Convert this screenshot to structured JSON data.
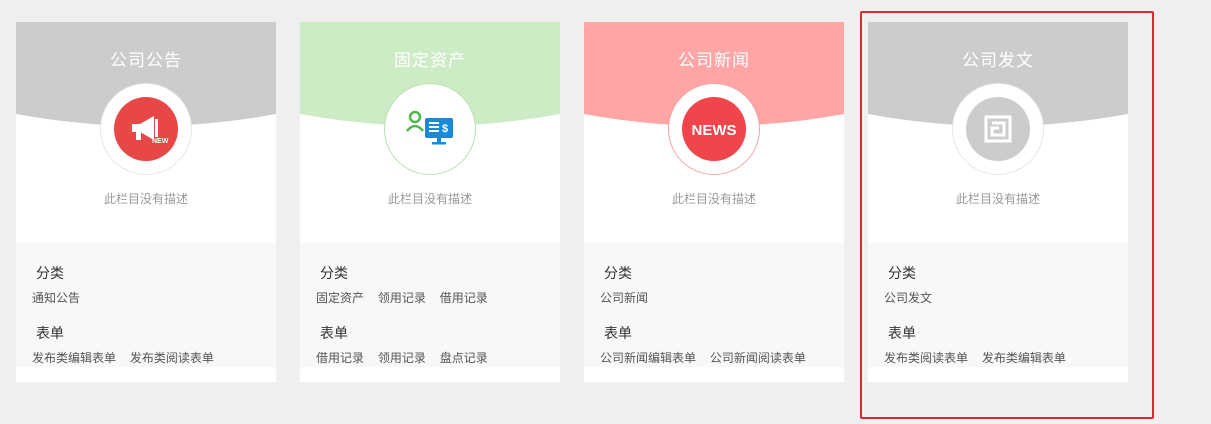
{
  "cards": [
    {
      "title": "公司公告",
      "header_color": "#cccccc",
      "icon": "megaphone-new-icon",
      "icon_color": "#e84747",
      "icon_text": "NEW",
      "description": "此栏目没有描述",
      "category_label": "分类",
      "categories": [
        "通知公告"
      ],
      "form_label": "表单",
      "forms": [
        "发布类编辑表单",
        "发布类阅读表单"
      ]
    },
    {
      "title": "固定资产",
      "header_color": "#cdecc6",
      "icon": "asset-monitor-icon",
      "icon_color": "#ffffff",
      "description": "此栏目没有描述",
      "category_label": "分类",
      "categories": [
        "固定资产",
        "领用记录",
        "借用记录"
      ],
      "form_label": "表单",
      "forms": [
        "借用记录",
        "领用记录",
        "盘点记录"
      ]
    },
    {
      "title": "公司新闻",
      "header_color": "#ffa5a5",
      "icon": "news-icon",
      "icon_color": "#f0454b",
      "icon_text": "NEWS",
      "description": "此栏目没有描述",
      "category_label": "分类",
      "categories": [
        "公司新闻"
      ],
      "form_label": "表单",
      "forms": [
        "公司新闻编辑表单",
        "公司新闻阅读表单"
      ]
    },
    {
      "title": "公司发文",
      "header_color": "#cccccc",
      "icon": "document-square-icon",
      "icon_color": "#cccccc",
      "description": "此栏目没有描述",
      "category_label": "分类",
      "categories": [
        "公司发文"
      ],
      "form_label": "表单",
      "forms": [
        "发布类阅读表单",
        "发布类编辑表单"
      ]
    }
  ],
  "highlight_color": "#e0282c"
}
